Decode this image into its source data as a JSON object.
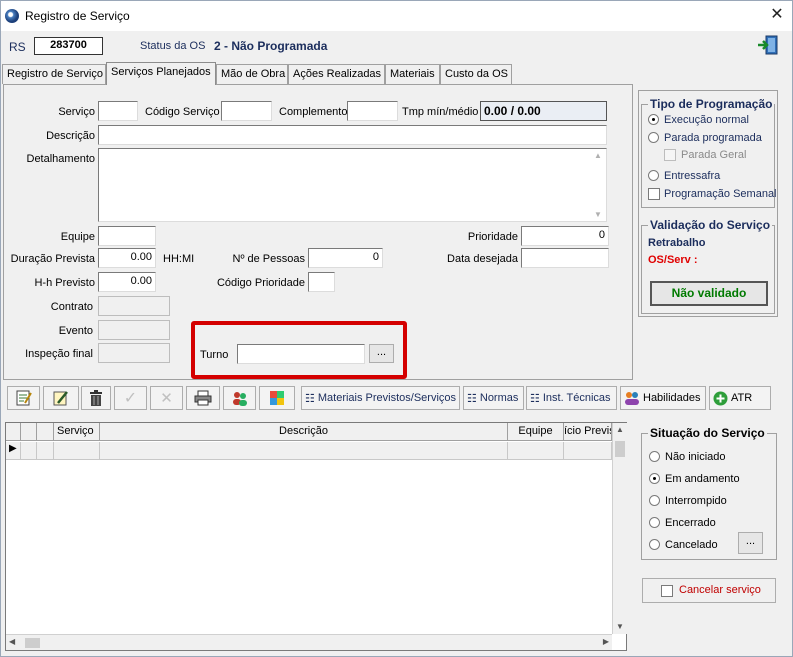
{
  "window": {
    "title": "Registro de Serviço",
    "close": "✕"
  },
  "header": {
    "rs_label": "RS",
    "rs_value": "283700",
    "status_label": "Status da OS",
    "status_value": "2 - Não Programada"
  },
  "tabs": [
    {
      "label": "Registro de Serviço"
    },
    {
      "label": "Serviços Planejados"
    },
    {
      "label": "Mão de Obra"
    },
    {
      "label": "Ações Realizadas"
    },
    {
      "label": "Materiais"
    },
    {
      "label": "Custo da OS"
    }
  ],
  "form": {
    "servico_label": "Serviço",
    "codigo_servico_label": "Código Serviço",
    "complemento_label": "Complemento",
    "tmp_label": "Tmp mín/médio",
    "tmp_value": "0.00 / 0.00",
    "descricao_label": "Descrição",
    "detalhamento_label": "Detalhamento",
    "equipe_label": "Equipe",
    "prioridade_label": "Prioridade",
    "prioridade_value": "0",
    "duracao_label": "Duração Prevista",
    "duracao_value": "0.00",
    "hhmi_label": "HH:MI",
    "n_pessoas_label": "Nº de Pessoas",
    "n_pessoas_value": "0",
    "data_desejada_label": "Data desejada",
    "hh_previsto_label": "H-h Previsto",
    "hh_previsto_value": "0.00",
    "codigo_prioridade_label": "Código Prioridade",
    "contrato_label": "Contrato",
    "evento_label": "Evento",
    "inspecao_label": "Inspeção final",
    "turno_label": "Turno",
    "turno_button": "..."
  },
  "tipo_programacao": {
    "title": "Tipo de Programação",
    "options": [
      {
        "label": "Execução normal",
        "selected": true
      },
      {
        "label": "Parada programada",
        "selected": false
      }
    ],
    "parada_geral": "Parada Geral",
    "entressafra": "Entressafra",
    "programacao_semanal": "Programação Semanal"
  },
  "validacao": {
    "title": "Validação do Serviço",
    "retrabalho": "Retrabalho",
    "os_serv": "OS/Serv :",
    "button": "Não validado"
  },
  "toolbar": {
    "materiais": "Materiais Previstos/Serviços",
    "normas": "Normas",
    "inst_tecnicas": "Inst. Técnicas",
    "habilidades": "Habilidades",
    "atr": "ATR"
  },
  "grid": {
    "columns": [
      "Serviço",
      "Descrição",
      "Equipe",
      "ício Previs"
    ]
  },
  "situacao": {
    "title": "Situação do Serviço",
    "options": [
      {
        "label": "Não iniciado",
        "selected": false
      },
      {
        "label": "Em andamento",
        "selected": true
      },
      {
        "label": "Interrompido",
        "selected": false
      },
      {
        "label": "Encerrado",
        "selected": false
      },
      {
        "label": "Cancelado",
        "selected": false
      }
    ],
    "cancel_button_dots": "...",
    "cancelar_servico": "Cancelar serviço"
  },
  "colors": {
    "accent_blue": "#1b2d5c",
    "alert_red": "#e00000",
    "validated_green": "#007a00",
    "highlight_red": "#d40000"
  }
}
